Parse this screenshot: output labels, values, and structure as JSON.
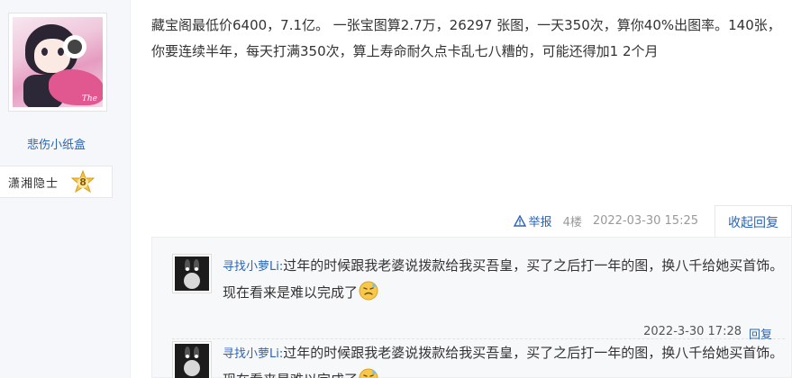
{
  "author": {
    "avatar_caption": "The",
    "username": "悲伤小纸盒",
    "rank_name": "潇湘隐士",
    "rank_level": "8"
  },
  "post": {
    "content": "藏宝阁最低价6400，7.1亿。 一张宝图算2.7万，26297 张图，一天350次，算你40%出图率。140张，你要连续半年，每天打满350次，算上寿命耐久点卡乱七八糟的，可能还得加1 2个月",
    "report_label": "举报",
    "floor": "4楼",
    "timestamp": "2022-03-30 15:25",
    "reply_toggle_label": "收起回复"
  },
  "replies": [
    {
      "user": "寻找小萝Li:",
      "text": "过年的时候跟我老婆说拨款给我买吾皇，买了之后打一年的图，换八千给她买首饰。现在看来是难以完成了",
      "emoji": "sweat-smile-emoji",
      "time": "2022-3-30 17:28",
      "reply_label": "回复"
    },
    {
      "user": "寻找小萝Li:",
      "text": "过年的时候跟我老婆说拨款给我买吾皇，买了之后打一年的图，换八千给她买首饰。现在看来是难以完成了",
      "emoji": "sweat-smile-emoji"
    }
  ],
  "colors": {
    "link": "#2d64b3",
    "muted": "#999999",
    "reply_bg": "#f7f8fa"
  }
}
